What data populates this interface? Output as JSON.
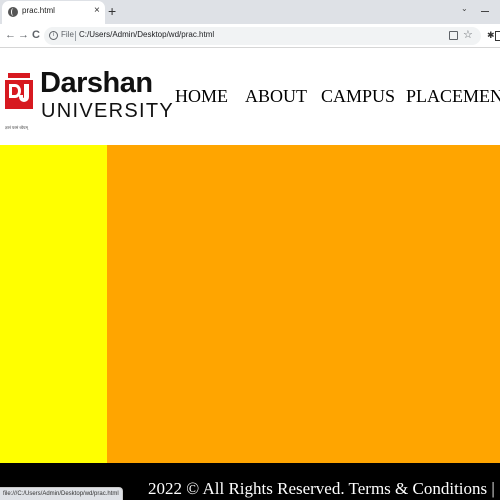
{
  "browser": {
    "tab_title": "prac.html",
    "tab_close": "×",
    "new_tab": "+",
    "tab_caret": "⌄",
    "back": "←",
    "forward": "→",
    "reload": "C",
    "url_scheme": "File",
    "url": "C:/Users/Admin/Desktop/wd/prac.html",
    "status_url": "file:///C:/Users/Admin/Desktop/wd/prac.html"
  },
  "header": {
    "logo_name": "Darshan",
    "logo_sub": "UNIVERSITY",
    "logo_tagline": "ज्ञानं परमं ध्येयम्",
    "logo_color": "#d71920",
    "nav": [
      {
        "label": "HOME"
      },
      {
        "label": "ABOUT"
      },
      {
        "label": "CAMPUS"
      },
      {
        "label": "PLACEMENT"
      }
    ]
  },
  "layout_colors": {
    "sidebar": "#ffff00",
    "main": "#ffa500",
    "footer": "#000000"
  },
  "footer": {
    "text": "2022 © All Rights Reserved. Terms & Conditions |"
  }
}
